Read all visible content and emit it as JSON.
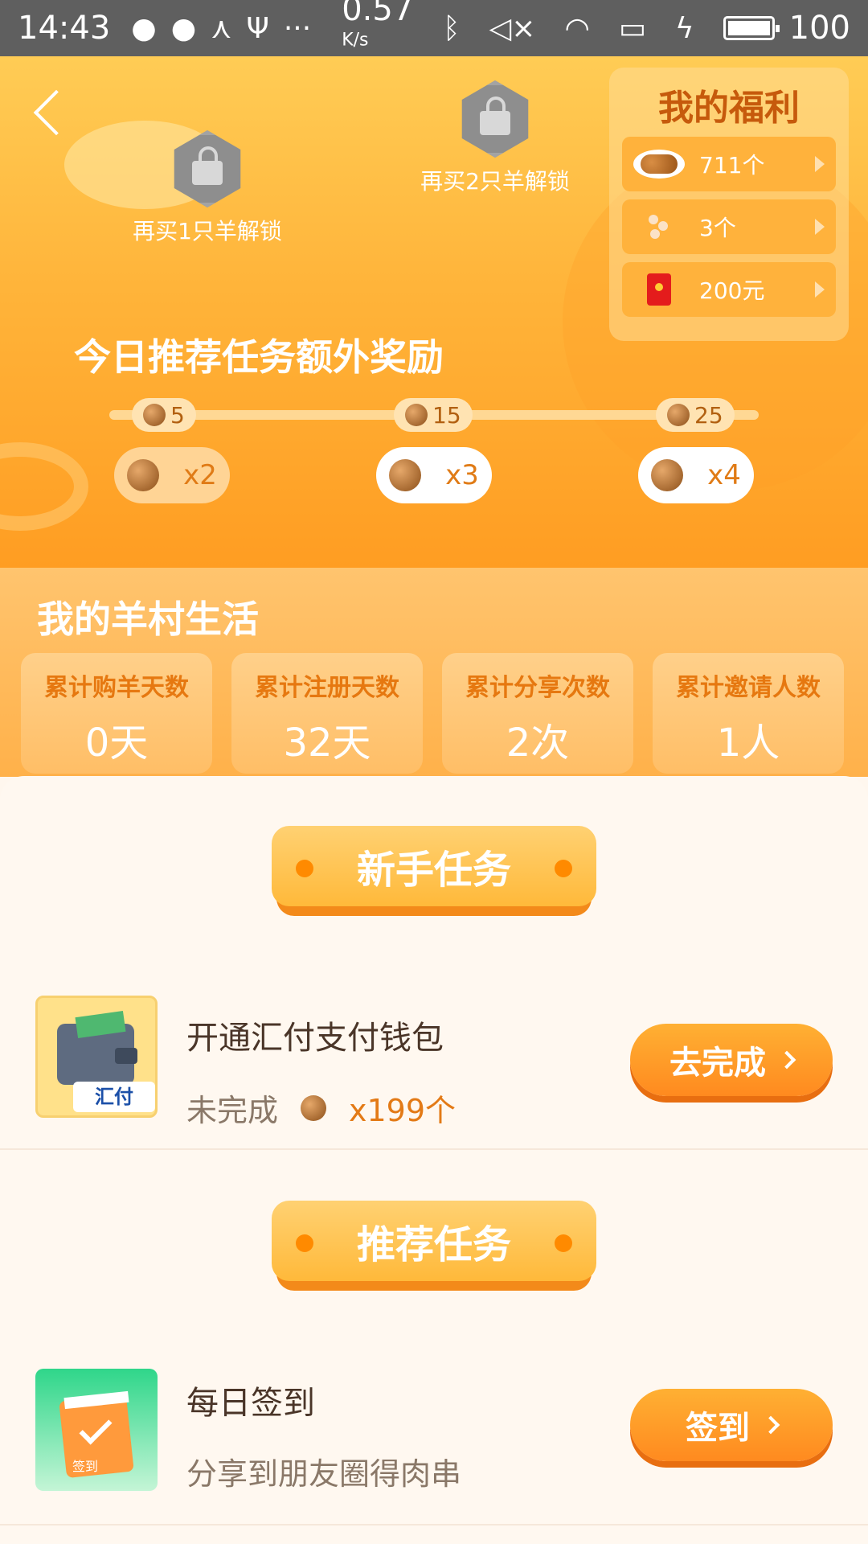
{
  "status_bar": {
    "time": "14:43",
    "speed": "0.57",
    "speed_unit": "K/s",
    "battery": "100"
  },
  "header": {
    "back_icon": "chevron-left-icon",
    "unlock_1": "再买1只羊解锁",
    "unlock_2": "再买2只羊解锁",
    "welfare": {
      "title": "我的福利",
      "items": [
        {
          "icon": "meat-plate-icon",
          "value": "711个"
        },
        {
          "icon": "skewer-icon",
          "value": "3个"
        },
        {
          "icon": "red-packet-icon",
          "value": "200元"
        }
      ]
    },
    "bonus_title": "今日推荐任务额外奖励",
    "milestones": [
      {
        "count": "5",
        "multiplier": "x2"
      },
      {
        "count": "15",
        "multiplier": "x3"
      },
      {
        "count": "25",
        "multiplier": "x4"
      }
    ]
  },
  "life": {
    "title": "我的羊村生活",
    "stats": [
      {
        "label": "累计购羊天数",
        "value": "0天"
      },
      {
        "label": "累计注册天数",
        "value": "32天"
      },
      {
        "label": "累计分享次数",
        "value": "2次"
      },
      {
        "label": "累计邀请人数",
        "value": "1人"
      }
    ]
  },
  "tasks": {
    "newbie_title": "新手任务",
    "newbie": {
      "name": "开通汇付支付钱包",
      "status": "未完成",
      "reward": "x199个",
      "button": "去完成",
      "icon_badge": "汇付"
    },
    "recommended_title": "推荐任务",
    "recommended": {
      "name": "每日签到",
      "desc": "分享到朋友圈得肉串",
      "button": "签到",
      "icon_badge": "签到"
    }
  },
  "colors": {
    "header_orange": "#ffb43a",
    "accent": "#ff8a1f",
    "reward_text": "#e37a16"
  }
}
